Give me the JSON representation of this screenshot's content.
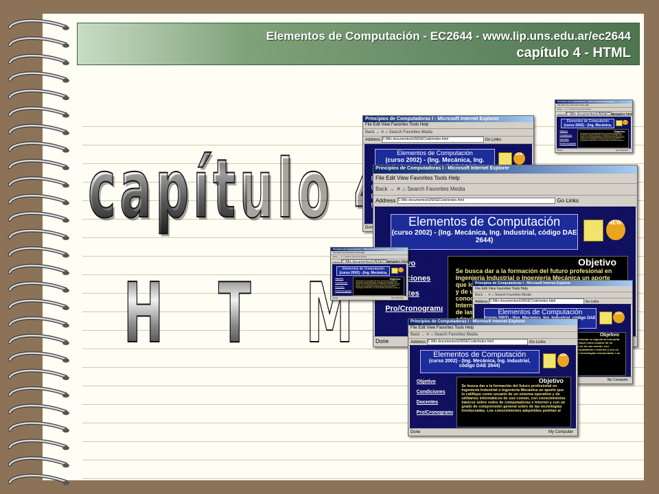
{
  "header": {
    "line1": "Elementos de Computación - EC2644 - www.lip.uns.edu.ar/ec2644",
    "line2": "capítulo 4 - HTML"
  },
  "title": {
    "main": "capítulo 4",
    "subtitle": "H T M L"
  },
  "browser": {
    "window_title": "Principios de Computadoras I - Microsoft Internet Explorer",
    "menu": "File   Edit   View   Favorites   Tools   Help",
    "toolbar": "Back  →  ✕  ⌂    Search   Favorites   Media",
    "address_label": "Address",
    "address_value": "C:\\Mis documentos\\UNS\\EC\\site\\index.html",
    "go": "Go",
    "links": "Links",
    "status_done": "Done",
    "status_computer": "My Computer"
  },
  "site": {
    "title": "Elementos de Computación",
    "subtitle": "(curso 2002) - (Ing. Mecánica, Ing. Industrial, código DAE 2644)",
    "new_badge": "NEW!",
    "menu": [
      "Objetivo",
      "Condiciones",
      "Docentes",
      "Pro/Cronograma"
    ],
    "panel_heading": "Objetivo",
    "panel_text": "Se busca dar a la formación del futuro profesional en Ingeniería Industrial o Ingeniería Mecánica un aporte que lo califique como usuario de un sistema operativo y de utilitarios informáticos de uso común, con conocimientos básicos sobre redes de computadoras e Internet y con un grado de comprensión general sobre de las tecnologías involucradas. Los conocimientos adquiridos podrían al"
  },
  "colors": {
    "background": "#8c7358",
    "paper": "#fffef4",
    "header_start": "#c9dcc4",
    "header_end": "#4f7450",
    "site_navy": "#101060"
  }
}
